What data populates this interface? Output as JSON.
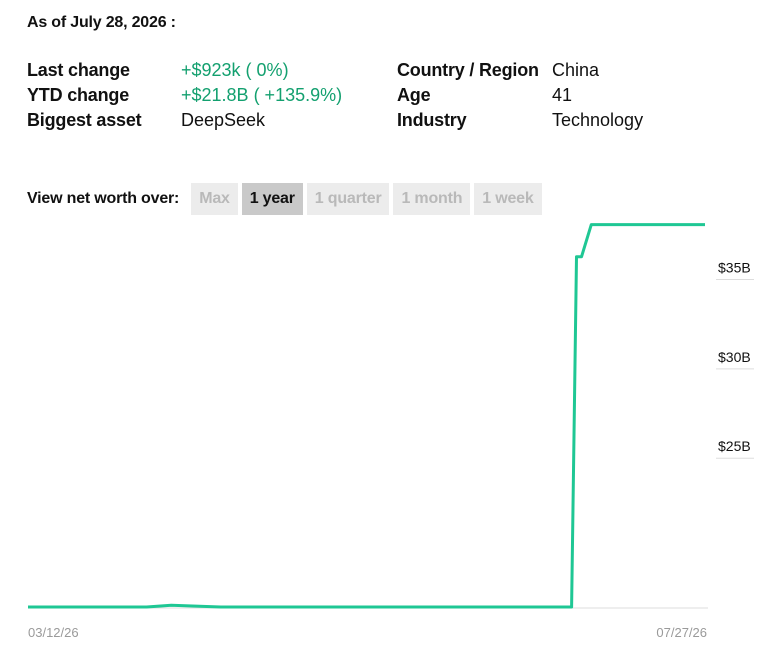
{
  "header": {
    "as_of": "As of July 28, 2026 :"
  },
  "stats_left": [
    {
      "label": "Last change",
      "value": "+$923k ( 0%)",
      "positive": true
    },
    {
      "label": "YTD change",
      "value": "+$21.8B ( +135.9%)",
      "positive": true
    },
    {
      "label": "Biggest asset",
      "value": "DeepSeek",
      "positive": false
    }
  ],
  "stats_right": [
    {
      "label": "Country / Region",
      "value": "China"
    },
    {
      "label": "Age",
      "value": "41"
    },
    {
      "label": "Industry",
      "value": "Technology"
    }
  ],
  "range_selector": {
    "label": "View net worth over:",
    "options": [
      {
        "label": "Max",
        "active": false
      },
      {
        "label": "1 year",
        "active": true
      },
      {
        "label": "1 quarter",
        "active": false
      },
      {
        "label": "1 month",
        "active": false
      },
      {
        "label": "1 week",
        "active": false
      }
    ]
  },
  "colors": {
    "line": "#1fc794",
    "positive_text": "#13a06f",
    "gridline": "#dddddd"
  },
  "chart_data": {
    "type": "line",
    "x_start_label": "03/12/26",
    "x_end_label": "07/27/26",
    "y_tick_labels": [
      "$35B",
      "$30B",
      "$25B"
    ],
    "y_tick_values": [
      35,
      30,
      25
    ],
    "ylim": [
      16,
      37.1
    ],
    "series": [
      {
        "values": [
          {
            "x": "2026-03-12",
            "y": 16.0
          },
          {
            "x": "2026-04-05",
            "y": 16.0
          },
          {
            "x": "2026-04-10",
            "y": 16.1
          },
          {
            "x": "2026-04-20",
            "y": 16.0
          },
          {
            "x": "2026-05-10",
            "y": 16.0
          },
          {
            "x": "2026-06-01",
            "y": 16.0
          },
          {
            "x": "2026-06-30",
            "y": 16.0
          },
          {
            "x": "2026-07-01",
            "y": 35.6
          },
          {
            "x": "2026-07-02",
            "y": 35.6
          },
          {
            "x": "2026-07-04",
            "y": 37.4
          },
          {
            "x": "2026-07-27",
            "y": 37.4
          }
        ]
      }
    ]
  }
}
